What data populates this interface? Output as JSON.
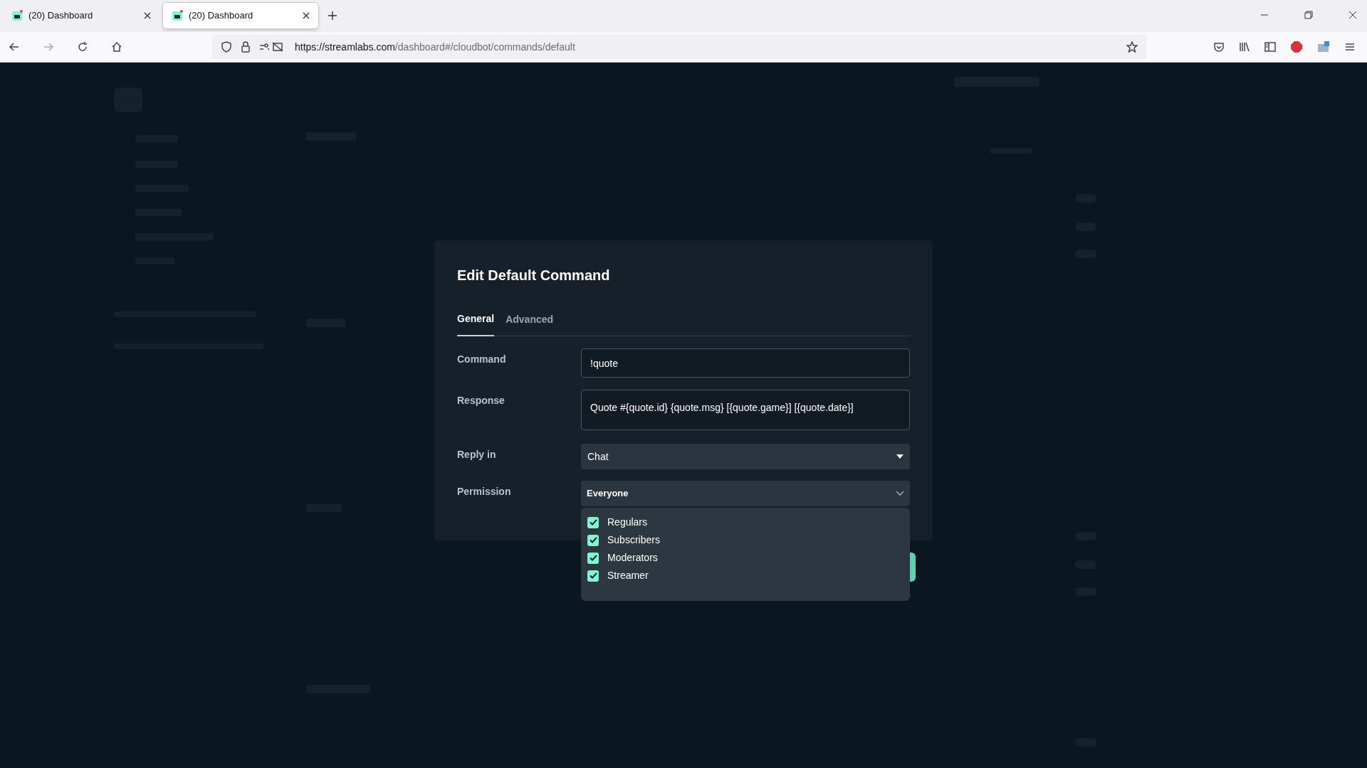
{
  "browser": {
    "tabs": [
      {
        "title": "(20) Dashboard",
        "selected": false
      },
      {
        "title": "(20) Dashboard",
        "selected": true
      }
    ],
    "url": {
      "host": "https://streamlabs.com",
      "path": "/dashboard#/cloudbot/commands/default"
    }
  },
  "dialog": {
    "title": "Edit Default Command",
    "tabs": [
      {
        "label": "General",
        "selected": true
      },
      {
        "label": "Advanced",
        "selected": false
      }
    ],
    "fields": [
      {
        "kind": "input",
        "label": "Command",
        "value": "!quote"
      },
      {
        "kind": "textarea",
        "label": "Response",
        "value": "Quote #{quote.id} {quote.msg} [{quote.game}] [{quote.date}]"
      },
      {
        "kind": "select",
        "label": "Reply in",
        "value": "Chat"
      },
      {
        "kind": "multiselect",
        "label": "Permission",
        "value": "Everyone",
        "options": [
          {
            "label": "Regulars",
            "checked": true
          },
          {
            "label": "Subscribers",
            "checked": true
          },
          {
            "label": "Moderators",
            "checked": true
          },
          {
            "label": "Streamer",
            "checked": true
          }
        ]
      }
    ]
  }
}
